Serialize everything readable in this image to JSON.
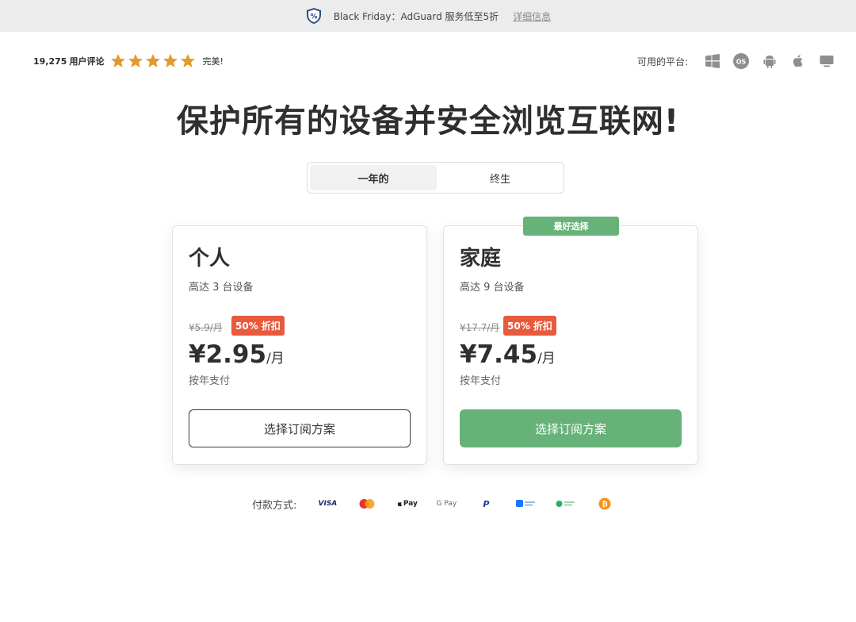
{
  "banner": {
    "promo_text": "Black Friday：AdGuard 服务低至5折",
    "link_text": "详细信息",
    "shield_icon": "shield-percent-icon"
  },
  "reviews": {
    "count": "19,275",
    "label": "用户评论",
    "stars": 5,
    "rating_word": "完美!",
    "star_color": "#e29a2d"
  },
  "platforms": {
    "label": "可用的平台:",
    "items": [
      "windows-icon",
      "macos-icon",
      "android-icon",
      "apple-icon",
      "desktop-icon"
    ]
  },
  "headline": "保护所有的设备并安全浏览互联网!",
  "billing_toggle": {
    "tabs": [
      {
        "label": "一年的",
        "active": true
      },
      {
        "label": "终生",
        "active": false
      }
    ]
  },
  "plans": [
    {
      "name": "个人",
      "devices": "高达 3 台设备",
      "old_price": "¥5.9/月",
      "discount": "50% 折扣",
      "price": "¥2.95",
      "per": "/月",
      "billing": "按年支付",
      "cta": "选择订阅方案"
    },
    {
      "name": "家庭",
      "devices": "高达 9 台设备",
      "old_price": "¥17.7/月",
      "discount": "50% 折扣",
      "price": "¥7.45",
      "per": "/月",
      "billing": "按年支付",
      "cta": "选择订阅方案",
      "badge": "最好选择"
    }
  ],
  "payments": {
    "label": "付款方式:",
    "methods": {
      "visa": "VISA",
      "applepay": "Pay",
      "googlepay": "G Pay",
      "paypal": "P"
    }
  },
  "colors": {
    "accent_green": "#67b279",
    "discount_red": "#e85a3c",
    "banner_bg": "#ececec"
  }
}
